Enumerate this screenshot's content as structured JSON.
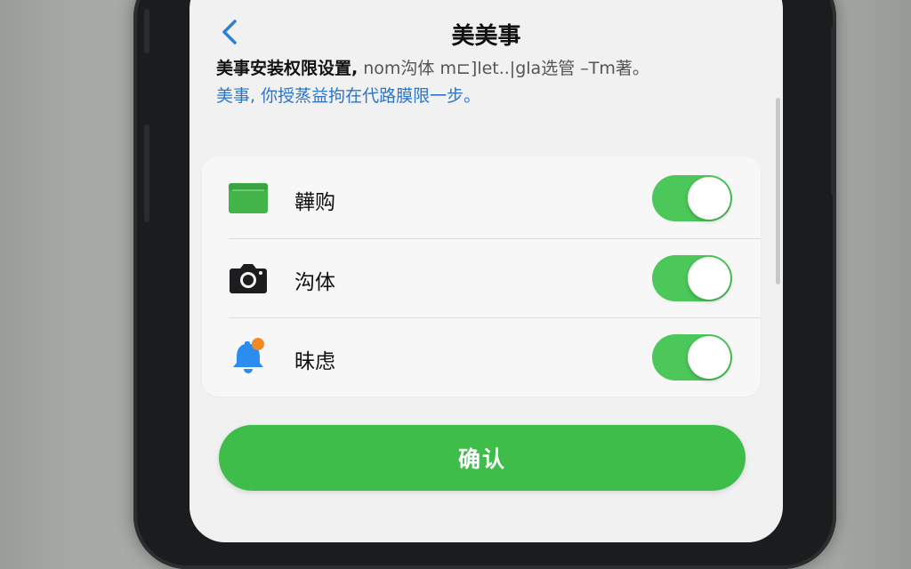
{
  "nav": {
    "title": "美美事",
    "back_icon": "chevron-left-icon"
  },
  "description": {
    "line1_bold": "美事安装权限设置,",
    "line1_rest": " nom沟体 m⊏]let..|gla选管 –Tm著。",
    "line2": "美事, 你授蒸益拘在代路膜限一步。"
  },
  "permissions": [
    {
      "icon": "folder-icon",
      "label": "韡购",
      "enabled": true
    },
    {
      "icon": "camera-icon",
      "label": "沟体",
      "enabled": true
    },
    {
      "icon": "bell-notification-icon",
      "label": "昧虑",
      "enabled": true
    }
  ],
  "confirm": {
    "label": "确认"
  },
  "colors": {
    "toggle_on": "#4cc759",
    "confirm_button": "#3fbd4b",
    "link_blue": "#2c75c9",
    "bell_blue": "#2d8cf0",
    "badge_orange": "#f08a24"
  }
}
